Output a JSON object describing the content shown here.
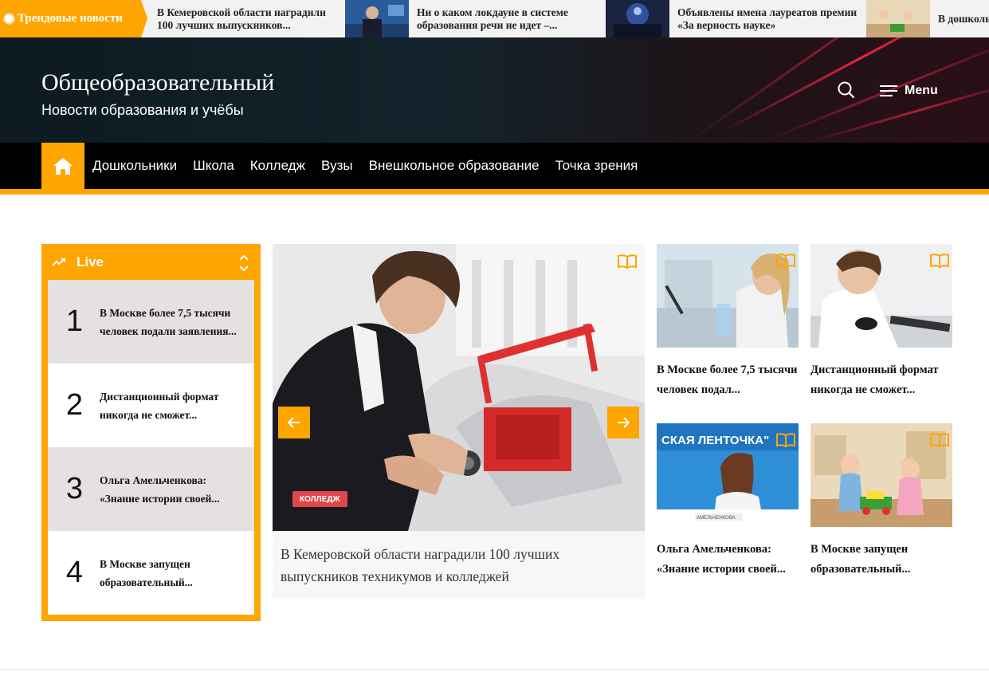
{
  "ticker": {
    "label": "Трендовые новости",
    "items": [
      {
        "text": "В Кемеровской области наградили 100 лучших выпускников..."
      },
      {
        "text": "Ни о каком локдауне в системе образования речи не идет –..."
      },
      {
        "text": "Объявлены имена лауреатов премии «За верность науке»"
      },
      {
        "text": "В дошкольных организациях..."
      }
    ]
  },
  "header": {
    "title": "Общеобразовательный",
    "tagline": "Новости образования и учёбы",
    "menu_label": "Menu"
  },
  "nav": {
    "items": [
      {
        "label": "Дошкольники"
      },
      {
        "label": "Школа"
      },
      {
        "label": "Колледж"
      },
      {
        "label": "Вузы"
      },
      {
        "label": "Внешкольное образование"
      },
      {
        "label": "Точка зрения"
      }
    ]
  },
  "live": {
    "title": "Live",
    "items": [
      {
        "num": "1",
        "text": "В Москве более 7,5 тысячи человек подали заявления..."
      },
      {
        "num": "2",
        "text": "Дистанционный формат никогда не сможет..."
      },
      {
        "num": "3",
        "text": "Ольга Амельченкова: «Знание истории своей..."
      },
      {
        "num": "4",
        "text": "В Москве запущен образовательный..."
      }
    ]
  },
  "slider": {
    "category": "КОЛЛЕДЖ",
    "caption": "В Кемеровской области наградили 100 лучших выпускников техникумов и колледжей"
  },
  "cards": [
    {
      "title": "В Москве более 7,5 тысячи человек подал..."
    },
    {
      "title": "Дистанционный формат никогда не сможет..."
    },
    {
      "title": "Ольга Амельченкова: «Знание истории своей..."
    },
    {
      "title": "В Москве запущен образовательный..."
    }
  ],
  "card3_image_text": {
    "banner": "СКАЯ ЛЕНТОЧКА\"",
    "nameplate": "АМЕЛЬЧЕНКОВА"
  },
  "colors": {
    "accent": "#ffa500",
    "badge": "#e0474a",
    "nav_bg": "#000000",
    "header_bg": "#13232b"
  }
}
